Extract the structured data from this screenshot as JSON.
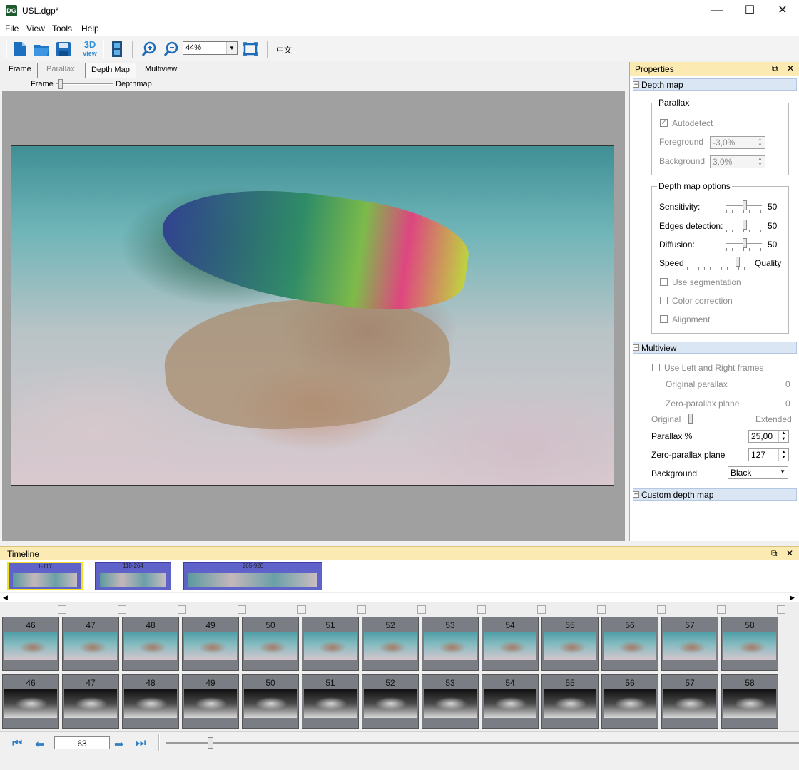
{
  "window": {
    "title": "USL.dgp*",
    "icon_label": "DG"
  },
  "menu": [
    "File",
    "View",
    "Tools",
    "Help"
  ],
  "toolbar": {
    "zoom": "44%",
    "icons": [
      "new-icon",
      "open-icon",
      "save-icon",
      "3d-view-icon",
      "film-icon",
      "zoom-in-icon",
      "zoom-out-icon",
      "fit-icon"
    ],
    "threed_label": "3D",
    "view_label": "view",
    "language": "中文"
  },
  "tabs": [
    "Frame",
    "Parallax",
    "Depth Map",
    "Multiview"
  ],
  "active_tab": "Depth Map",
  "viewer": {
    "left_label": "Frame",
    "right_label": "Depthmap",
    "blend": 0.05
  },
  "properties": {
    "title": "Properties",
    "depth_map": {
      "section_label": "Depth map",
      "parallax": {
        "title": "Parallax",
        "autodetect_label": "Autodetect",
        "autodetect_checked": true,
        "foreground_label": "Foreground",
        "foreground_value": "-3,0%",
        "background_label": "Background",
        "background_value": "3,0%"
      },
      "options": {
        "title": "Depth map options",
        "sensitivity_label": "Sensitivity:",
        "sensitivity_value": "50",
        "edges_label": "Edges detection:",
        "edges_value": "50",
        "diffusion_label": "Diffusion:",
        "diffusion_value": "50",
        "speed_label": "Speed",
        "quality_label": "Quality",
        "use_segmentation": "Use segmentation",
        "color_correction": "Color correction",
        "alignment": "Alignment"
      }
    },
    "multiview": {
      "section_label": "Multiview",
      "use_lr_label": "Use Left and Right frames",
      "original_parallax_label": "Original parallax",
      "original_parallax_value": "0",
      "zero_plane_label": "Zero-parallax plane",
      "zero_plane_value": "0",
      "original_label": "Original",
      "extended_label": "Extended",
      "parallax_pct_label": "Parallax %",
      "parallax_pct_value": "25,00",
      "zero_plane_input_label": "Zero-parallax plane",
      "zero_plane_input_value": "127",
      "background_label": "Background",
      "background_value": "Black"
    },
    "custom_depth_label": "Custom depth map"
  },
  "timeline": {
    "title": "Timeline",
    "segments": [
      "1-117",
      "118-264",
      "265-920"
    ],
    "frames": [
      "46",
      "47",
      "48",
      "49",
      "50",
      "51",
      "52",
      "53",
      "54",
      "55",
      "56",
      "57",
      "58"
    ],
    "current_frame": "63"
  }
}
